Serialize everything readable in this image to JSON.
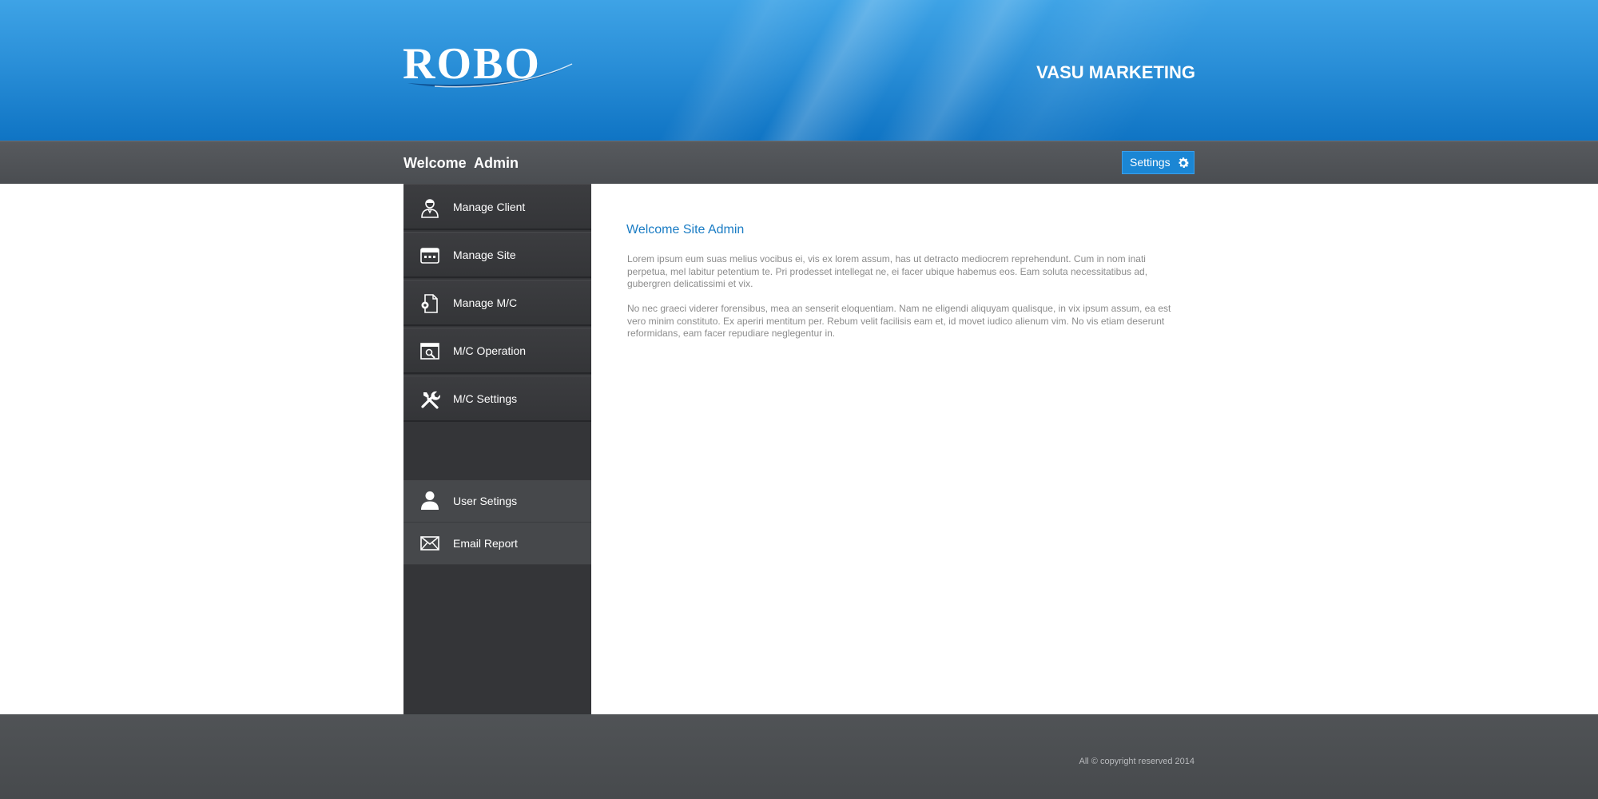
{
  "header": {
    "logo_text": "ROBO",
    "company_name": "VASU MARKETING"
  },
  "topbar": {
    "welcome": "Welcome  Admin",
    "settings_label": "Settings",
    "settings_icon": "gear-icon"
  },
  "sidebar": {
    "items": [
      {
        "label": "Manage Client",
        "icon": "client-user-icon"
      },
      {
        "label": "Manage Site",
        "icon": "site-window-icon"
      },
      {
        "label": "Manage M/C",
        "icon": "document-gear-icon"
      },
      {
        "label": "M/C Operation",
        "icon": "window-search-icon"
      },
      {
        "label": "M/C Settings",
        "icon": "tools-icon"
      }
    ],
    "secondary_items": [
      {
        "label": "User Setings",
        "icon": "user-icon"
      },
      {
        "label": "Email Report",
        "icon": "envelope-icon"
      }
    ]
  },
  "main": {
    "title": "Welcome Site Admin",
    "paragraphs": [
      "Lorem ipsum eum suas melius vocibus ei, vis ex lorem assum, has ut detracto mediocrem reprehendunt. Cum in nom inati perpetua, mel labitur petentium te. Pri prodesset intellegat ne, ei facer ubique habemus eos. Eam soluta necessitatibus ad, gubergren delicatissimi et vix.",
      "No nec graeci viderer forensibus, mea an senserit eloquentiam. Nam ne eligendi aliquyam qualisque, in vix ipsum assum, ea est vero minim constituto. Ex aperiri mentitum per. Rebum velit facilisis eam et, id movet iudico alienum vim. No vis etiam deserunt reformidans, eam facer repudiare neglegentur in."
    ]
  },
  "footer": {
    "copyright": "All © copyright reserved 2014"
  },
  "colors": {
    "header_blue": "#2a8fd8",
    "accent_blue": "#1b86d4",
    "title_blue": "#1a7cc4",
    "sidebar_dark": "#343538",
    "bar_gray": "#4a4d51"
  }
}
